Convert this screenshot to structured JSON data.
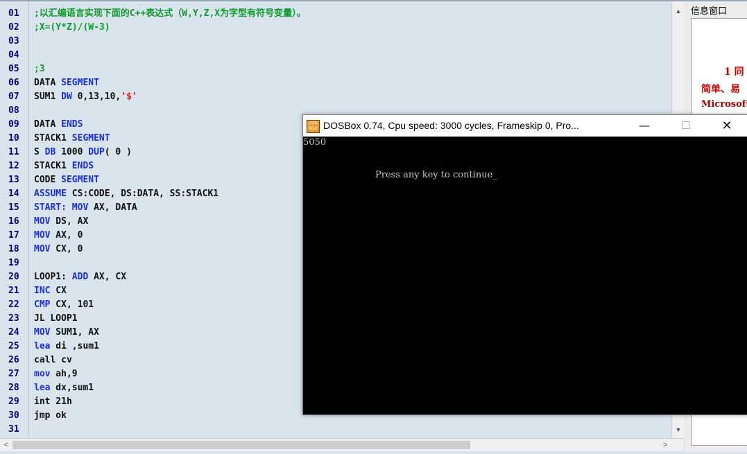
{
  "editor": {
    "lines": [
      {
        "n": "01",
        "parts": [
          {
            "t": ";以汇编语言实现下面的C++表达式（W,Y,Z,X为字型有符号变量）。",
            "c": "cm"
          }
        ]
      },
      {
        "n": "02",
        "parts": [
          {
            "t": ";X=(Y*Z)/(W-3)",
            "c": "cm"
          }
        ]
      },
      {
        "n": "03",
        "parts": []
      },
      {
        "n": "04",
        "parts": []
      },
      {
        "n": "05",
        "parts": [
          {
            "t": ";3",
            "c": "cm"
          }
        ]
      },
      {
        "n": "06",
        "parts": [
          {
            "t": "DATA "
          },
          {
            "t": "SEGMENT",
            "c": "kw"
          }
        ]
      },
      {
        "n": "07",
        "parts": [
          {
            "t": "SUM1 "
          },
          {
            "t": "DW",
            "c": "kw"
          },
          {
            "t": " 0,13,10,"
          },
          {
            "t": "'$'",
            "c": "st"
          }
        ]
      },
      {
        "n": "08",
        "parts": []
      },
      {
        "n": "09",
        "parts": [
          {
            "t": "DATA "
          },
          {
            "t": "ENDS",
            "c": "kw"
          }
        ]
      },
      {
        "n": "10",
        "parts": [
          {
            "t": "STACK1 "
          },
          {
            "t": "SEGMENT",
            "c": "kw"
          }
        ]
      },
      {
        "n": "11",
        "parts": [
          {
            "t": "S "
          },
          {
            "t": "DB",
            "c": "kw"
          },
          {
            "t": " 1000 "
          },
          {
            "t": "DUP",
            "c": "kw"
          },
          {
            "t": "( 0 )"
          }
        ]
      },
      {
        "n": "12",
        "parts": [
          {
            "t": "STACK1 "
          },
          {
            "t": "ENDS",
            "c": "kw"
          }
        ]
      },
      {
        "n": "13",
        "parts": [
          {
            "t": "CODE "
          },
          {
            "t": "SEGMENT",
            "c": "kw"
          }
        ]
      },
      {
        "n": "14",
        "parts": [
          {
            "t": "ASSUME",
            "c": "kw"
          },
          {
            "t": " CS:CODE, DS:DATA, SS:STACK1"
          }
        ]
      },
      {
        "n": "15",
        "parts": [
          {
            "t": "START:",
            "c": "kw"
          },
          {
            "t": " "
          },
          {
            "t": "MOV",
            "c": "kw"
          },
          {
            "t": " AX, DATA"
          }
        ]
      },
      {
        "n": "16",
        "parts": [
          {
            "t": "MOV",
            "c": "kw"
          },
          {
            "t": " DS, AX"
          }
        ]
      },
      {
        "n": "17",
        "parts": [
          {
            "t": "MOV",
            "c": "kw"
          },
          {
            "t": " AX, 0"
          }
        ]
      },
      {
        "n": "18",
        "parts": [
          {
            "t": "MOV",
            "c": "kw"
          },
          {
            "t": " CX, 0"
          }
        ]
      },
      {
        "n": "19",
        "parts": []
      },
      {
        "n": "20",
        "parts": [
          {
            "t": "LOOP1: "
          },
          {
            "t": "ADD",
            "c": "kw"
          },
          {
            "t": " AX, CX"
          }
        ]
      },
      {
        "n": "21",
        "parts": [
          {
            "t": "INC",
            "c": "kw"
          },
          {
            "t": " CX"
          }
        ]
      },
      {
        "n": "22",
        "parts": [
          {
            "t": "CMP",
            "c": "kw"
          },
          {
            "t": " CX, 101"
          }
        ]
      },
      {
        "n": "23",
        "parts": [
          {
            "t": "JL LOOP1"
          }
        ]
      },
      {
        "n": "24",
        "parts": [
          {
            "t": "MOV",
            "c": "kw"
          },
          {
            "t": " SUM1, AX"
          }
        ]
      },
      {
        "n": "25",
        "parts": [
          {
            "t": "lea",
            "c": "kw"
          },
          {
            "t": " di ,sum1"
          }
        ]
      },
      {
        "n": "26",
        "parts": [
          {
            "t": "call cv"
          }
        ]
      },
      {
        "n": "27",
        "parts": [
          {
            "t": "mov",
            "c": "kw"
          },
          {
            "t": " ah,9"
          }
        ]
      },
      {
        "n": "28",
        "parts": [
          {
            "t": "lea",
            "c": "kw"
          },
          {
            "t": " dx,sum1"
          }
        ]
      },
      {
        "n": "29",
        "parts": [
          {
            "t": "int 21h"
          }
        ]
      },
      {
        "n": "30",
        "parts": [
          {
            "t": "jmp ok"
          }
        ]
      },
      {
        "n": "31",
        "parts": []
      }
    ]
  },
  "panel": {
    "title": "信息窗口",
    "text1": "1 同",
    "text2": "简单、易",
    "text3": "Microsoft"
  },
  "dosbox": {
    "title": "DOSBox 0.74, Cpu speed:    3000 cycles, Frameskip  0, Pro...",
    "icon_text": "DOS BOX",
    "output_line1": "5050",
    "output_line2": "Press any key to continue_",
    "minimize": "—",
    "maximize": "☐",
    "close": "✕"
  },
  "scroll": {
    "up": "▲",
    "down": "▼",
    "left": "<",
    "right": ">"
  },
  "colors": {
    "editor_bg": "#d9e4ec",
    "keyword": "#1a2de8",
    "comment": "#0f9a2c",
    "string": "#d01818",
    "panel_red": "#d00000",
    "panel_dark_red": "#a00000"
  }
}
